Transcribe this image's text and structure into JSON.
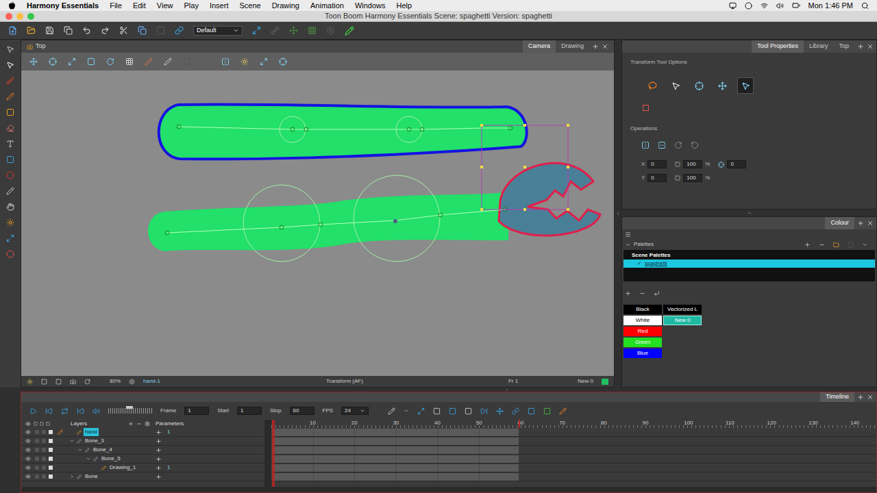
{
  "menubar": {
    "app": "Harmony Essentials",
    "items": [
      "File",
      "Edit",
      "View",
      "Play",
      "Insert",
      "Scene",
      "Drawing",
      "Animation",
      "Windows",
      "Help"
    ],
    "clock": "Mon 1:46 PM"
  },
  "window": {
    "title": "Toon Boom Harmony Essentials Scene: spaghetti Version: spaghetti"
  },
  "toolbar": {
    "workspace": "Default"
  },
  "camera_view": {
    "title": "Top",
    "tabs": [
      {
        "label": "Camera",
        "selected": true
      },
      {
        "label": "Drawing",
        "selected": false
      }
    ],
    "status": {
      "zoom": "80%",
      "layer": "hand-1",
      "tool": "Transform (AF)",
      "frame": "Fr 1",
      "colour": "New 0"
    }
  },
  "tool_properties": {
    "tabs": [
      {
        "label": "Tool Properties",
        "selected": true
      },
      {
        "label": "Library",
        "selected": false
      },
      {
        "label": "Top",
        "selected": false
      }
    ],
    "title": "Transform Tool Options",
    "modes": [
      {
        "selected": false
      },
      {
        "selected": false
      },
      {
        "selected": false
      },
      {
        "selected": false
      },
      {
        "selected": true
      }
    ],
    "operations_label": "Operations",
    "x": {
      "label": "X",
      "value": "0"
    },
    "y": {
      "label": "Y",
      "value": "0"
    },
    "width": {
      "value": "100",
      "unit": "%"
    },
    "height": {
      "value": "100",
      "unit": "%"
    },
    "angle": {
      "value": "0"
    }
  },
  "colour": {
    "tab": "Colour",
    "palettes_label": "Palettes",
    "list_header": "Scene Palettes",
    "check": "✓",
    "palettes": [
      {
        "name": "spaghetti",
        "checked": true,
        "selected": true
      }
    ],
    "swatches": [
      {
        "name": "Black",
        "color": "#000000",
        "selected": false
      },
      {
        "name": "White",
        "color": "#ffffff",
        "selected": false
      },
      {
        "name": "Red",
        "color": "#ff0000",
        "selected": false
      },
      {
        "name": "Green",
        "color": "#22e022",
        "selected": false
      },
      {
        "name": "Blue",
        "color": "#0000ff",
        "selected": false
      },
      {
        "name": "Vectorized L",
        "color": "#000000",
        "selected": false
      },
      {
        "name": "New 0",
        "color": "#1fb9a4",
        "selected": true
      }
    ]
  },
  "timeline": {
    "tab": "Timeline",
    "controls": {
      "frame_label": "Frame",
      "frame": "1",
      "start_label": "Start",
      "start": "1",
      "stop_label": "Stop",
      "stop": "60",
      "fps_label": "FPS",
      "fps": "24"
    },
    "columns": [
      "Layers",
      "Parameters"
    ],
    "layers": [
      {
        "name": "hand",
        "kind": "drawing",
        "depth": 0,
        "selected": true,
        "expandable": false,
        "expanded": false,
        "value": "1"
      },
      {
        "name": "Bone_3",
        "kind": "bone",
        "depth": 0,
        "selected": false,
        "expandable": true,
        "expanded": true,
        "value": ""
      },
      {
        "name": "Bone_4",
        "kind": "bone",
        "depth": 1,
        "selected": false,
        "expandable": true,
        "expanded": true,
        "value": ""
      },
      {
        "name": "Bone_5",
        "kind": "bone",
        "depth": 2,
        "selected": false,
        "expandable": true,
        "expanded": true,
        "value": ""
      },
      {
        "name": "Drawing_1",
        "kind": "drawing",
        "depth": 3,
        "selected": false,
        "expandable": false,
        "expanded": false,
        "value": "1"
      },
      {
        "name": "Bone",
        "kind": "bone",
        "depth": 0,
        "selected": false,
        "expandable": true,
        "expanded": false,
        "value": ""
      }
    ],
    "ruler": [
      "10",
      "20",
      "30",
      "40",
      "50",
      "60",
      "70",
      "80",
      "90",
      "100",
      "110",
      "120",
      "130",
      "140"
    ]
  }
}
